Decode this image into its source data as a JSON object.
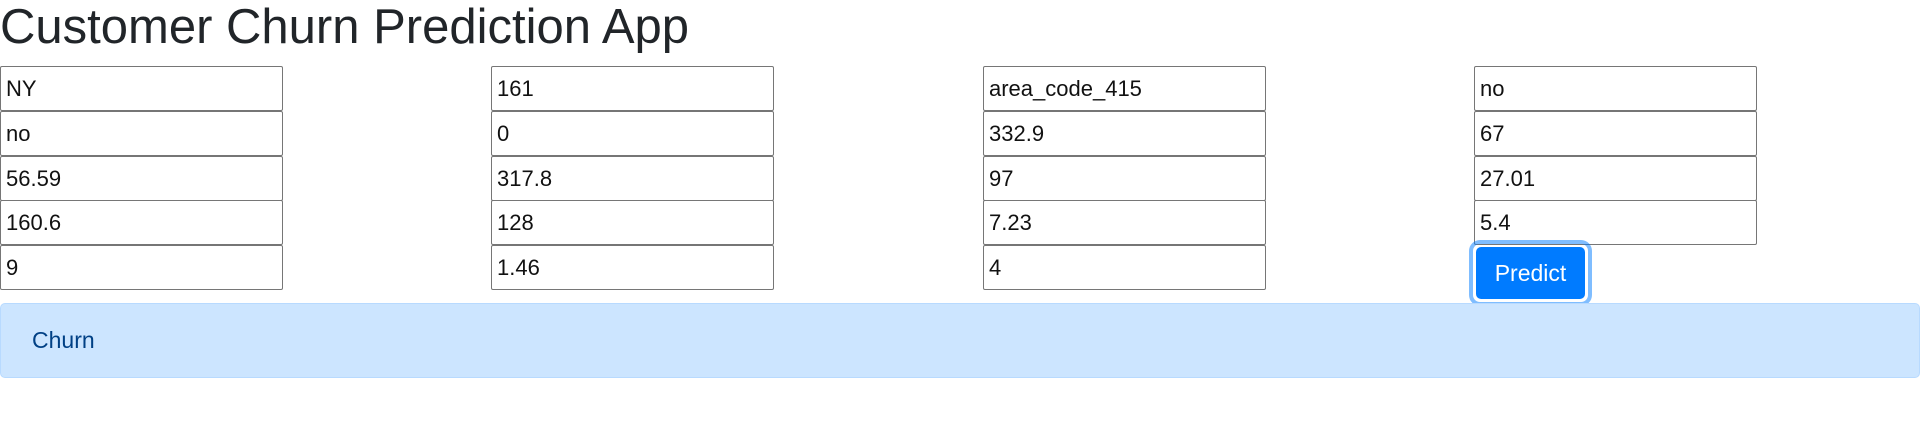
{
  "app": {
    "title": "Customer Churn Prediction App"
  },
  "form": {
    "fields": [
      "NY",
      "161",
      "area_code_415",
      "no",
      "no",
      "0",
      "332.9",
      "67",
      "56.59",
      "317.8",
      "97",
      "27.01",
      "160.6",
      "128",
      "7.23",
      "5.4",
      "9",
      "1.46",
      "4"
    ],
    "submit_label": "Predict"
  },
  "result": {
    "text": "Churn"
  },
  "colors": {
    "primary": "#007bff",
    "alert_background": "#cce5ff",
    "alert_text": "#004085"
  }
}
